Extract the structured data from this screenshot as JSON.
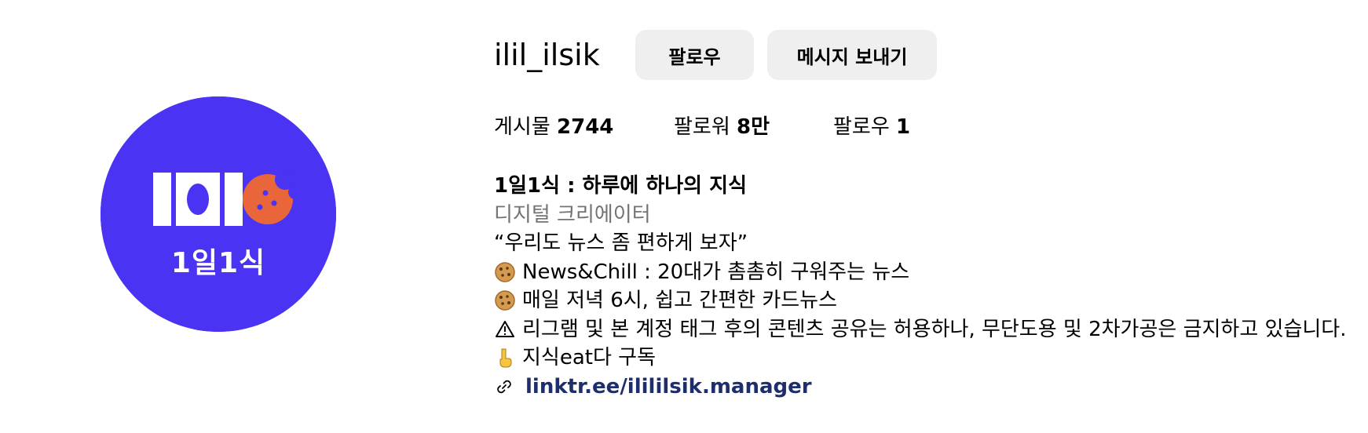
{
  "profile": {
    "username": "ilil_ilsik",
    "avatar_text": "1일1식",
    "buttons": {
      "follow": "팔로우",
      "message": "메시지 보내기"
    },
    "stats": {
      "posts_label": "게시물",
      "posts_value": "2744",
      "followers_label": "팔로워",
      "followers_value": "8만",
      "following_label": "팔로우",
      "following_value": "1"
    },
    "bio": {
      "name": "1일1식 : 하루에 하나의 지식",
      "category": "디지털 크리에이터",
      "lines": [
        "“우리도 뉴스 좀 편하게 보자”",
        "News&Chill : 20대가 촘촘히 구워주는 뉴스",
        "매일 저녁 6시, 쉽고 간편한 카드뉴스",
        "리그램 및 본 계정 태그 후의 콘텐츠 공유는 허용하나, 무단도용 및 2차가공은 금지하고 있습니다.",
        "지식eat다 구독"
      ],
      "link": "linktr.ee/ilililsik.manager"
    },
    "icons": {
      "cookie": "cookie-icon",
      "warning": "warning-icon",
      "pointing_down": "pointing-down-icon",
      "link": "link-icon"
    },
    "colors": {
      "avatar_bg": "#4a33f2",
      "cookie": "#e8663a",
      "button_bg": "#efefef",
      "link": "#1e2d6b",
      "category": "#737373"
    }
  }
}
